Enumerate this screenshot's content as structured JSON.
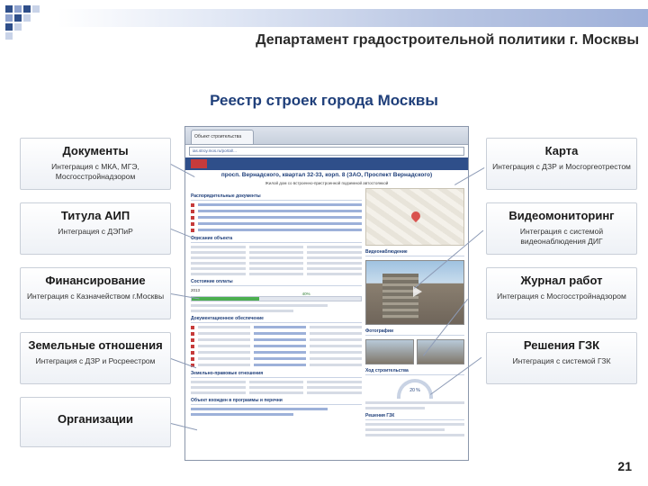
{
  "header": {
    "org_title": "Департамент градостроительной политики г. Москвы"
  },
  "main": {
    "title": "Реестр строек города Москвы"
  },
  "left_cards": [
    {
      "title": "Документы",
      "desc": "Интеграция с МКА, МГЭ, Мосгосстройнадзором"
    },
    {
      "title": "Титула АИП",
      "desc": "Интеграция с ДЭПиР"
    },
    {
      "title": "Финансирование",
      "desc": "Интеграция с Казначейством г.Москвы"
    },
    {
      "title": "Земельные отношения",
      "desc": "Интеграция с ДЗР и Росреестром"
    },
    {
      "title": "Организации",
      "desc": ""
    }
  ],
  "right_cards": [
    {
      "title": "Карта",
      "desc": "Интеграция с ДЗР и Мосгоргеотрестом"
    },
    {
      "title": "Видеомониторинг",
      "desc": "Интеграция с системой видеонаблюдения ДИГ"
    },
    {
      "title": "Журнал работ",
      "desc": "Интеграция с Мосгосстройнадзором"
    },
    {
      "title": "Решения ГЗК",
      "desc": "Интеграция с системой ГЗК"
    }
  ],
  "screenshot": {
    "tab_label": "Объект строительства",
    "url": "ias.stroy.mos.ru/portal/...",
    "object_title": "просп. Вернадского, квартал 32-33, корп. 8 (ЗАО, Проспект Вернадского)",
    "object_subtitle": "Жилой дом со встроенно-пристроенной подземной автостоянкой",
    "section_docs": "Распорядительные документы",
    "section_object": "Описание объекта",
    "section_finance": "Состояние оплаты",
    "finance_year": "2013",
    "finance_percent": 0.4,
    "finance_percent_label": "40%",
    "section_permits": "Документационное обеспечение",
    "section_land": "Земельно-правовые отношения",
    "section_programs": "Объект вхожден в программы и перечни",
    "section_video": "Видеонаблюдение",
    "section_photos": "Фотографии",
    "section_progress": "Ход строительства",
    "progress_label": "20 %",
    "section_gzk": "Решения ГЗК"
  },
  "page_number": "21",
  "colors": {
    "accent": "#1f3f7a",
    "card_border": "#c9cfd8",
    "leader": "#8d9bb6"
  }
}
